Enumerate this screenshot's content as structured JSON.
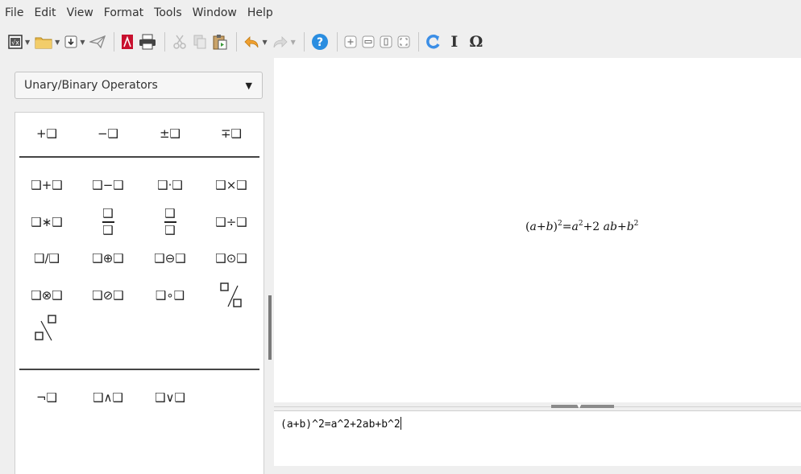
{
  "menubar": {
    "items": [
      "File",
      "Edit",
      "View",
      "Format",
      "Tools",
      "Window",
      "Help"
    ]
  },
  "toolbar": {
    "buttons": [
      "new-document",
      "open",
      "save",
      "export-direct",
      "export-pdf",
      "print",
      "cut",
      "copy",
      "paste",
      "undo",
      "redo",
      "help",
      "zoom-in",
      "zoom-out",
      "zoom-100",
      "show-all",
      "update",
      "symbols",
      "special-character"
    ],
    "icons": {
      "symbols": "I",
      "special_character": "Ω"
    },
    "colors": {
      "pdf": "#c8102e",
      "help": "#2a8de0",
      "undo": "#f0a030",
      "update": "#3b8ee6"
    }
  },
  "sidebar": {
    "category": "Unary/Binary Operators",
    "unary": [
      "+❑",
      "−❑",
      "±❑",
      "∓❑"
    ],
    "binary": [
      [
        "❑+❑",
        "❑−❑",
        "❑·❑",
        "❑×❑"
      ],
      [
        "❑∗❑",
        "",
        "",
        "❑÷❑"
      ],
      [
        "❑/❑",
        "❑⊕❑",
        "❑⊖❑",
        "❑⊙❑"
      ],
      [
        "❑⊗❑",
        "❑⊘❑",
        "❑∘❑",
        ""
      ],
      [
        ""
      ]
    ],
    "logic": [
      "¬❑",
      "❑∧❑",
      "❑∨❑"
    ],
    "placeholder": "❑"
  },
  "formula": {
    "rendered": {
      "lhs": "(a+b)",
      "exp": "2",
      "eq": "=",
      "a": "a",
      "b": "b",
      "plus": "+",
      "two_ab": "2 ab",
      "plus2": "+"
    },
    "command": "(a+b)^2=a^2+2ab+b^2"
  }
}
